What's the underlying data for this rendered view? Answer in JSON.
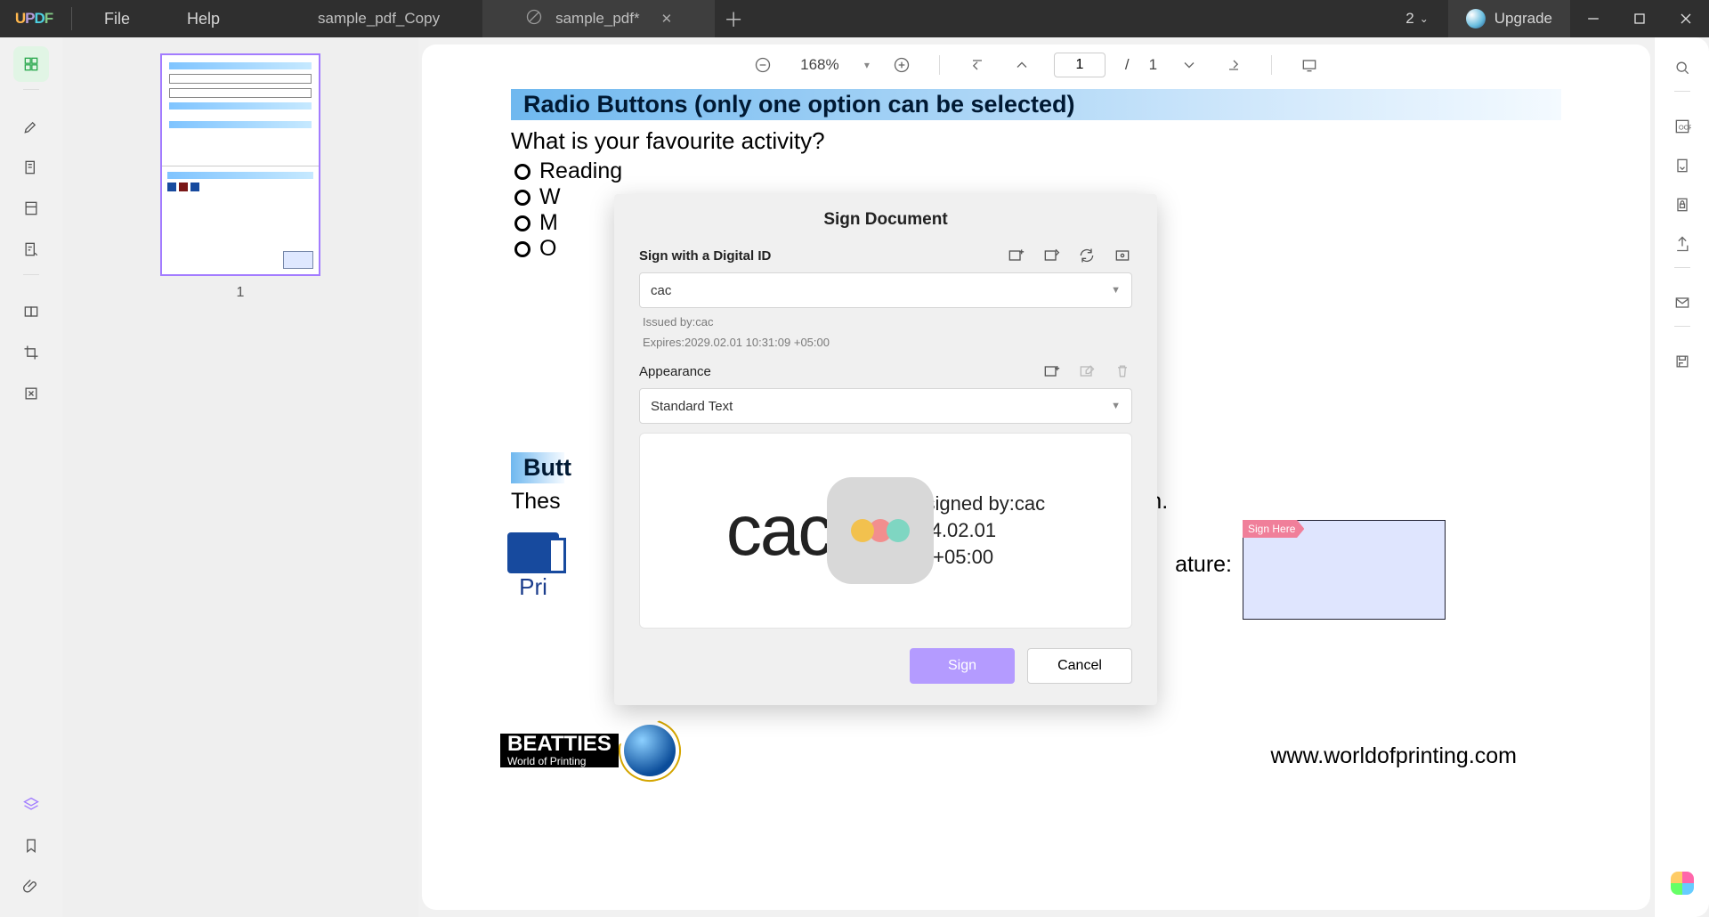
{
  "titlebar": {
    "logo": "UPDF",
    "menu": {
      "file": "File",
      "help": "Help"
    },
    "tabs": [
      {
        "label": "sample_pdf_Copy",
        "active": false,
        "dirty": false,
        "icon": false
      },
      {
        "label": "sample_pdf*",
        "active": true,
        "dirty": true,
        "icon": true
      }
    ],
    "count": "2",
    "upgrade": "Upgrade"
  },
  "toolbar": {
    "zoom": "168%",
    "page_current": "1",
    "page_sep": "/",
    "page_total": "1"
  },
  "thumbs": {
    "page_label": "1"
  },
  "document": {
    "section_radio": "Radio Buttons (only one option can be selected)",
    "question": "What is your favourite activity?",
    "options": [
      "Reading",
      "W",
      "M",
      "O"
    ],
    "section_buttons_cut": "Butt",
    "desc_left": "Thes",
    "desc_right": "een.",
    "print_label": "Pri",
    "signature_label": "ature:",
    "sign_here": "Sign Here",
    "beatties": {
      "line1": "BEATTIES",
      "line2": "World of Printing"
    },
    "website": "www.worldofprinting.com"
  },
  "modal": {
    "title": "Sign Document",
    "sign_with": "Sign with a Digital ID",
    "id_value": "cac",
    "issued_by": "Issued by:cac",
    "expires": "Expires:2029.02.01 10:31:09 +05:00",
    "appearance_label": "Appearance",
    "appearance_value": "Standard Text",
    "preview_name": "cac",
    "signed_by": "Digitally signed by:cac",
    "date_line1": "Date:2024.02.01",
    "date_line2": "10:35:18 +05:00",
    "sign": "Sign",
    "cancel": "Cancel"
  }
}
